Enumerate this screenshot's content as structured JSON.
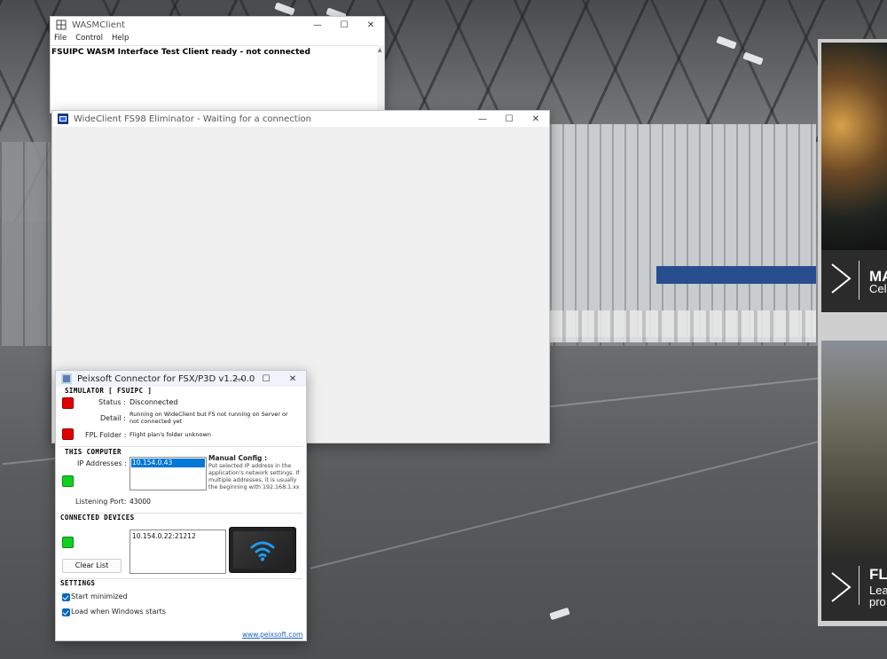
{
  "colors": {
    "status_red": "#e00000",
    "status_green": "#10d020",
    "selection_blue": "#0078d7",
    "link_blue": "#1b5fc4",
    "wifi_blue": "#1e9bf0",
    "title_bar": "#ffffff"
  },
  "wasm_client": {
    "title": "WASMClient",
    "menu": [
      "File",
      "Control",
      "Help"
    ],
    "message": "FSUIPC WASM Interface Test Client ready - not connected"
  },
  "wide_client": {
    "title": "WideClient FS98 Eliminator - Waiting for a connection"
  },
  "peixsoft": {
    "title": "Peixsoft Connector for FSX/P3D v1.2.0.0",
    "simulator": {
      "heading": "SIMULATOR  [ FSUIPC ]",
      "status_label": "Status :",
      "status_value": "Disconnected",
      "detail_label": "Detail :",
      "detail_value": "Running on WideClient but FS not running on Server or not connected yet",
      "fpl_label": "FPL Folder :",
      "fpl_value": "Flight plan's folder unknown"
    },
    "this_computer": {
      "heading": "THIS COMPUTER",
      "ip_label": "IP Addresses :",
      "ip_addresses": [
        "10.154.0.43"
      ],
      "manual_config_title": "Manual Config :",
      "manual_config_text": "Put selected IP address in the application's network settings. If multiple addresses, it is usually the beginning with 192.168.1.xx",
      "port_label": "Listening Port:",
      "port_value": "43000"
    },
    "connected_devices": {
      "heading": "CONNECTED DEVICES",
      "devices": [
        "10.154.0.22:21212"
      ],
      "clear_button": "Clear List"
    },
    "settings": {
      "heading": "SETTINGS",
      "start_minimized": "Start minimized",
      "load_on_start": "Load when Windows starts"
    },
    "link": "www.peixsoft.com"
  },
  "side_cards": [
    {
      "title": "MA",
      "subtitle": "Cel"
    },
    {
      "title": "FL",
      "subtitle": "Lea",
      "subtitle2": "pro"
    }
  ],
  "window_controls": {
    "minimize": "—",
    "maximize": "☐",
    "close": "✕"
  }
}
